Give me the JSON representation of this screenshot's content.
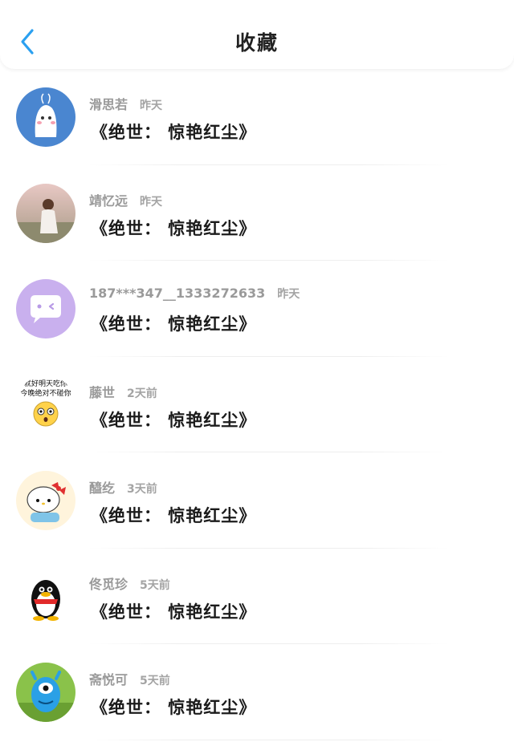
{
  "header": {
    "title": "收藏",
    "back_icon": "chevron-left-icon",
    "accent_color": "#2ba0f0"
  },
  "favorites": [
    {
      "name": "滑思若",
      "time": "昨天",
      "work": "《绝世： 惊艳红尘》",
      "avatar_icon": "cartoon-ghost-avatar"
    },
    {
      "name": "靖忆远",
      "time": "昨天",
      "work": "《绝世： 惊艳红尘》",
      "avatar_icon": "girl-photo-avatar"
    },
    {
      "name": "187***347__1333272633",
      "time": "昨天",
      "work": "《绝世： 惊艳红尘》",
      "avatar_icon": "chat-bubble-avatar"
    },
    {
      "name": "藤世",
      "time": "2天前",
      "work": "《绝世： 惊艳红尘》",
      "avatar_icon": "meme-emoji-avatar",
      "avatar_caption": [
        "就好明天吃你",
        "今晚绝对不碰你"
      ]
    },
    {
      "name": "醯纥",
      "time": "3天前",
      "work": "《绝世： 惊艳红尘》",
      "avatar_icon": "hello-kitty-avatar"
    },
    {
      "name": "佟觅珍",
      "time": "5天前",
      "work": "《绝世： 惊艳红尘》",
      "avatar_icon": "penguin-avatar"
    },
    {
      "name": "斋悦可",
      "time": "5天前",
      "work": "《绝世： 惊艳红尘》",
      "avatar_icon": "blue-monster-avatar"
    }
  ]
}
